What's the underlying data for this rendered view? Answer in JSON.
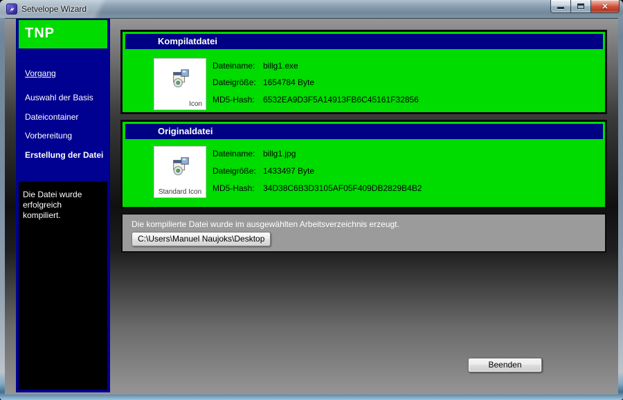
{
  "window": {
    "title": "Setvelope Wizard"
  },
  "controls": {
    "close_glyph": "✕"
  },
  "sidebar": {
    "logo": "TNP",
    "nav_items": [
      {
        "label": "Vorgang"
      },
      {
        "label": "Auswahl der Basis"
      },
      {
        "label": "Dateicontainer"
      },
      {
        "label": "Vorbereitung"
      },
      {
        "label": "Erstellung der Datei"
      }
    ],
    "status_message": "Die Datei wurde erfolgreich kompiliert."
  },
  "panels": [
    {
      "title": "Kompilatdatei",
      "icon_caption": "Icon",
      "rows": [
        {
          "label": "Dateiname:",
          "value": "billg1.exe"
        },
        {
          "label": "Dateigröße:",
          "value": "1654784 Byte"
        },
        {
          "label": "MD5-Hash:",
          "value": "6532EA9D3F5A14913FB6C45161F32856"
        }
      ]
    },
    {
      "title": "Originaldatei",
      "icon_caption": "Standard Icon",
      "rows": [
        {
          "label": "Dateiname:",
          "value": "billg1.jpg"
        },
        {
          "label": "Dateigröße:",
          "value": "1433497 Byte"
        },
        {
          "label": "MD5-Hash:",
          "value": "34D38C6B3D3105AF05F409DB2829B4B2"
        }
      ]
    }
  ],
  "result": {
    "message": "Die kompilierte Datei wurde im ausgewählten Arbeitsverzeichnis erzeugt.",
    "working_directory": "C:\\Users\\Manuel Naujoks\\Desktop"
  },
  "footer": {
    "quit_label": "Beenden"
  },
  "colors": {
    "accent_green": "#00DC00",
    "navy": "#000084",
    "sidebar_navy": "#000091",
    "panel_gray": "#9B9B9B"
  }
}
